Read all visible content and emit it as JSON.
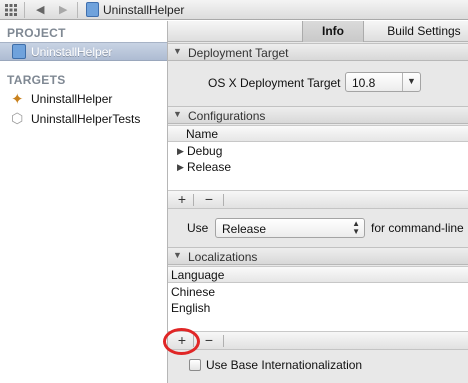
{
  "jumpbar": {
    "title": "UninstallHelper",
    "back_icon": "back-arrow",
    "forward_icon": "forward-arrow",
    "grid_icon": "related-items-grid"
  },
  "navigator": {
    "project_header": "PROJECT",
    "project_item": "UninstallHelper",
    "targets_header": "TARGETS",
    "targets": [
      {
        "label": "UninstallHelper",
        "icon": "app-target-icon"
      },
      {
        "label": "UninstallHelperTests",
        "icon": "test-bundle-icon"
      }
    ]
  },
  "tabs": {
    "info": "Info",
    "build_settings": "Build Settings"
  },
  "deployment": {
    "header": "Deployment Target",
    "label": "OS X Deployment Target",
    "value": "10.8"
  },
  "configurations": {
    "header": "Configurations",
    "column": "Name",
    "rows": [
      "Debug",
      "Release"
    ],
    "add": "+",
    "remove": "−",
    "use_label": "Use",
    "use_value": "Release",
    "use_suffix": "for command-line"
  },
  "localizations": {
    "header": "Localizations",
    "column": "Language",
    "rows": [
      "Chinese",
      "English"
    ],
    "add": "+",
    "remove": "−",
    "base_checkbox": "Use Base Internationalization",
    "base_checked": false
  },
  "highlight": {
    "color": "#e02626",
    "target": "localizations-add-button"
  }
}
